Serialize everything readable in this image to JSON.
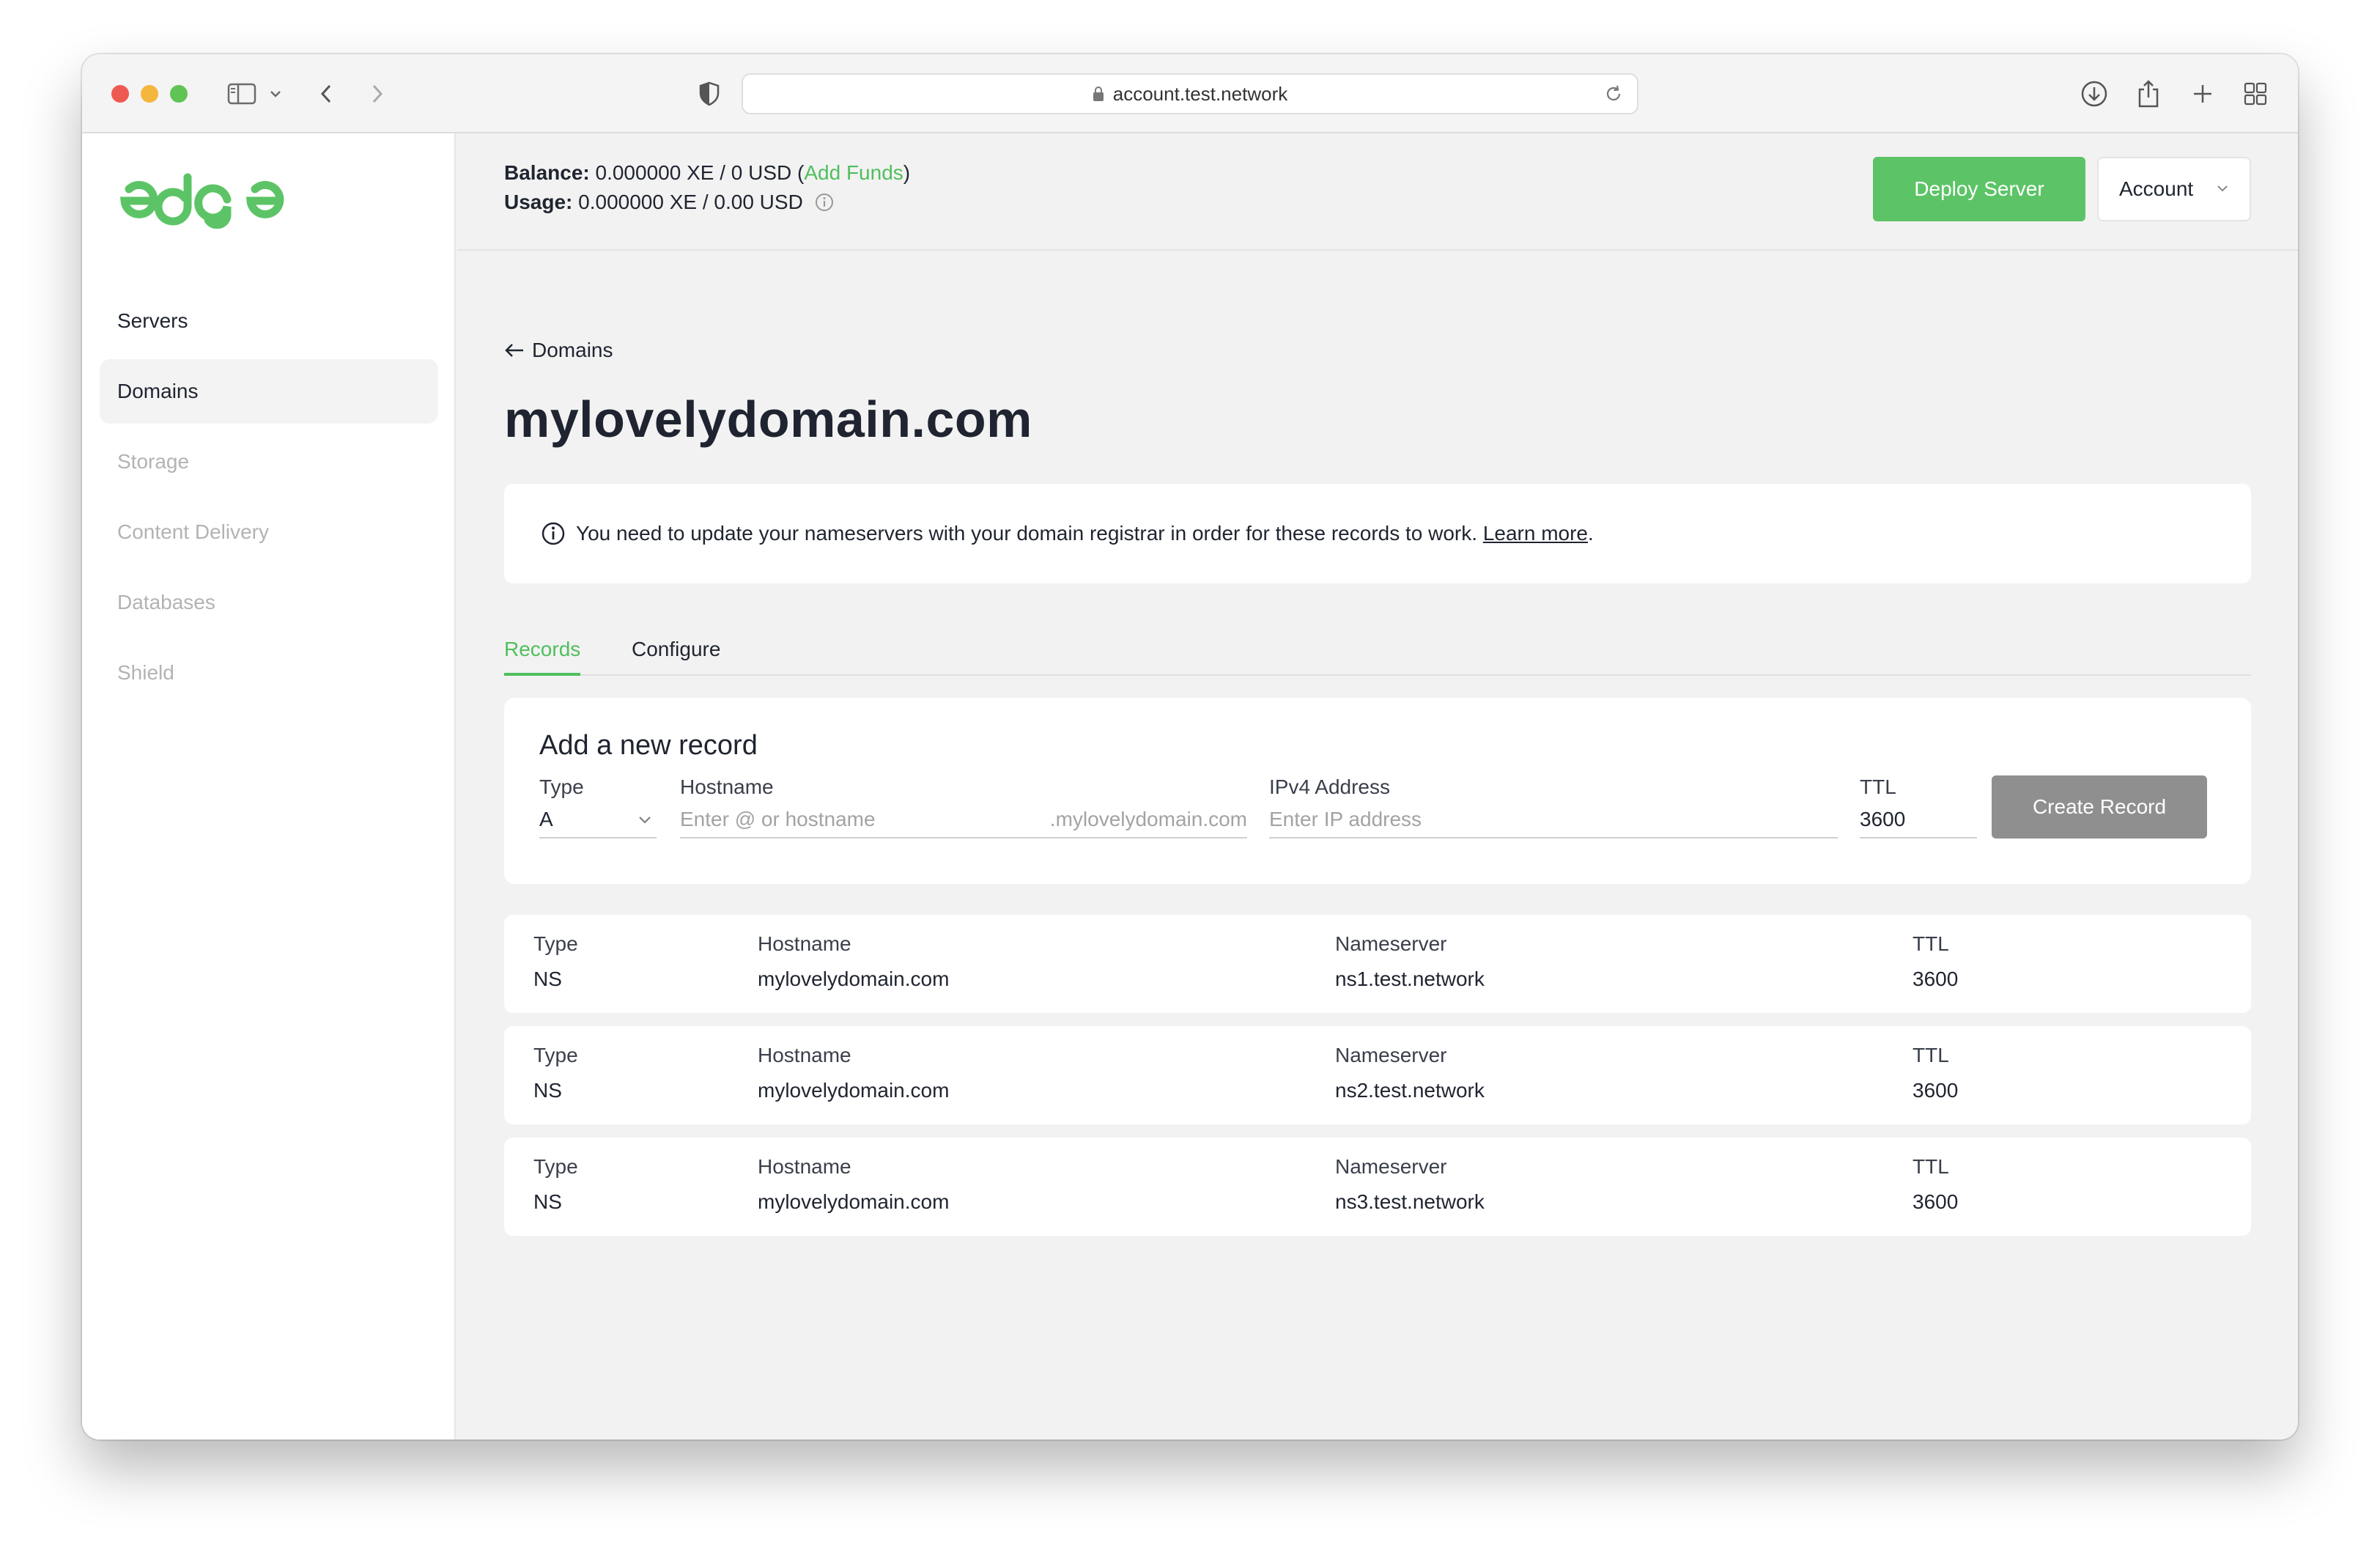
{
  "browser": {
    "url": "account.test.network"
  },
  "sidebar": {
    "logo_text": "edge",
    "items": [
      {
        "label": "Servers"
      },
      {
        "label": "Domains"
      },
      {
        "label": "Storage"
      },
      {
        "label": "Content Delivery"
      },
      {
        "label": "Databases"
      },
      {
        "label": "Shield"
      }
    ],
    "active": "Domains"
  },
  "header": {
    "balance_label": "Balance:",
    "balance_value": "0.000000 XE / 0 USD",
    "add_funds": "Add Funds",
    "usage_label": "Usage:",
    "usage_value": "0.000000 XE / 0.00 USD",
    "deploy_button": "Deploy Server",
    "account_button": "Account"
  },
  "page": {
    "back_label": "Domains",
    "title": "mylovelydomain.com",
    "notice_text": "You need to update your nameservers with your domain registrar in order for these records to work.",
    "notice_link": "Learn more",
    "notice_end": "."
  },
  "tabs": [
    {
      "label": "Records",
      "active": true
    },
    {
      "label": "Configure",
      "active": false
    }
  ],
  "add_record": {
    "title": "Add a new record",
    "type_label": "Type",
    "type_value": "A",
    "hostname_label": "Hostname",
    "hostname_placeholder": "Enter @ or hostname",
    "hostname_suffix": ".mylovelydomain.com",
    "ip_label": "IPv4 Address",
    "ip_placeholder": "Enter IP address",
    "ttl_label": "TTL",
    "ttl_value": "3600",
    "create_button": "Create Record"
  },
  "records": {
    "headers": {
      "type": "Type",
      "hostname": "Hostname",
      "nameserver": "Nameserver",
      "ttl": "TTL"
    },
    "rows": [
      {
        "type": "NS",
        "hostname": "mylovelydomain.com",
        "nameserver": "ns1.test.network",
        "ttl": "3600"
      },
      {
        "type": "NS",
        "hostname": "mylovelydomain.com",
        "nameserver": "ns2.test.network",
        "ttl": "3600"
      },
      {
        "type": "NS",
        "hostname": "mylovelydomain.com",
        "nameserver": "ns3.test.network",
        "ttl": "3600"
      }
    ]
  },
  "colors": {
    "accent_green": "#5cc466",
    "disabled_button": "#8f8f8f"
  }
}
